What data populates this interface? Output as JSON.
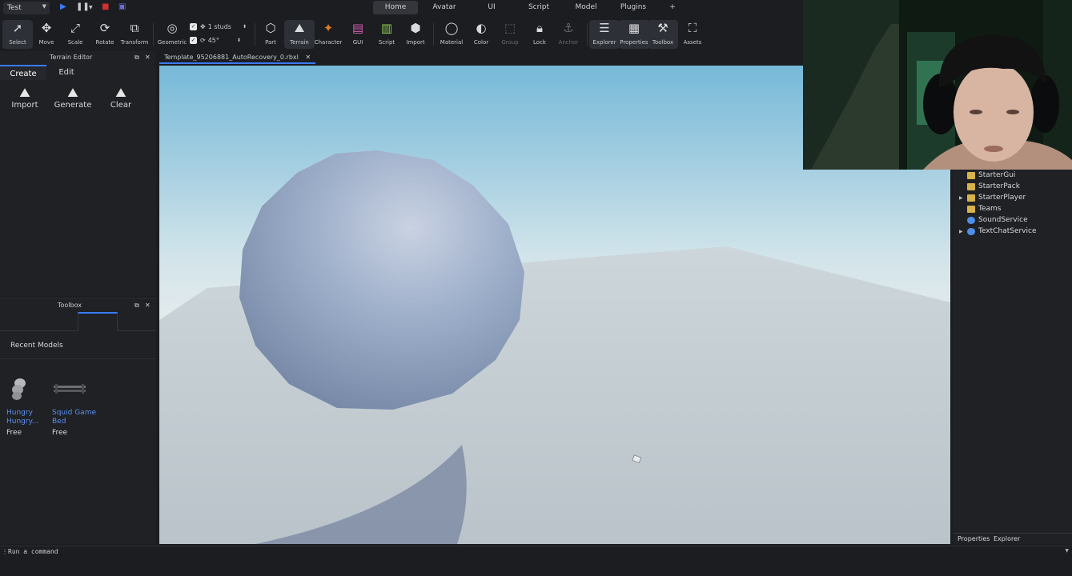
{
  "run_mode": {
    "selected": "Test"
  },
  "menu_tabs": [
    "Home",
    "Avatar",
    "UI",
    "Script",
    "Model",
    "Plugins"
  ],
  "menu_add": "+",
  "ribbon": {
    "tools": [
      "Select",
      "Move",
      "Scale",
      "Rotate",
      "Transform",
      "Geometric",
      "Part",
      "Terrain",
      "Character",
      "GUI",
      "Script",
      "Import",
      "Material",
      "Color",
      "Group",
      "Lock",
      "Anchor",
      "Explorer",
      "Properties",
      "Toolbox",
      "Assets"
    ],
    "snap_move": "1 studs",
    "snap_rotate": "45°"
  },
  "terrain_editor": {
    "title": "Terrain Editor",
    "tabs": [
      "Create",
      "Edit"
    ],
    "buttons": [
      "Import",
      "Generate",
      "Clear"
    ]
  },
  "toolbox": {
    "title": "Toolbox",
    "section": "Recent Models",
    "models": [
      {
        "name": "Hungry Hungry...",
        "price": "Free"
      },
      {
        "name": "Squid Game Bed",
        "price": "Free"
      }
    ]
  },
  "document_tab": "Template_95206881_AutoRecovery_0.rbxl",
  "explorer": {
    "items": [
      "StarterGui",
      "StarterPack",
      "StarterPlayer",
      "Teams",
      "SoundService",
      "TextChatService"
    ],
    "footer_tabs": [
      "Properties",
      "Explorer"
    ]
  },
  "command_bar": {
    "placeholder": "Run a command"
  },
  "colors": {
    "accent": "#3a7bff",
    "link": "#5b8ff0",
    "panel": "#1f2125"
  }
}
